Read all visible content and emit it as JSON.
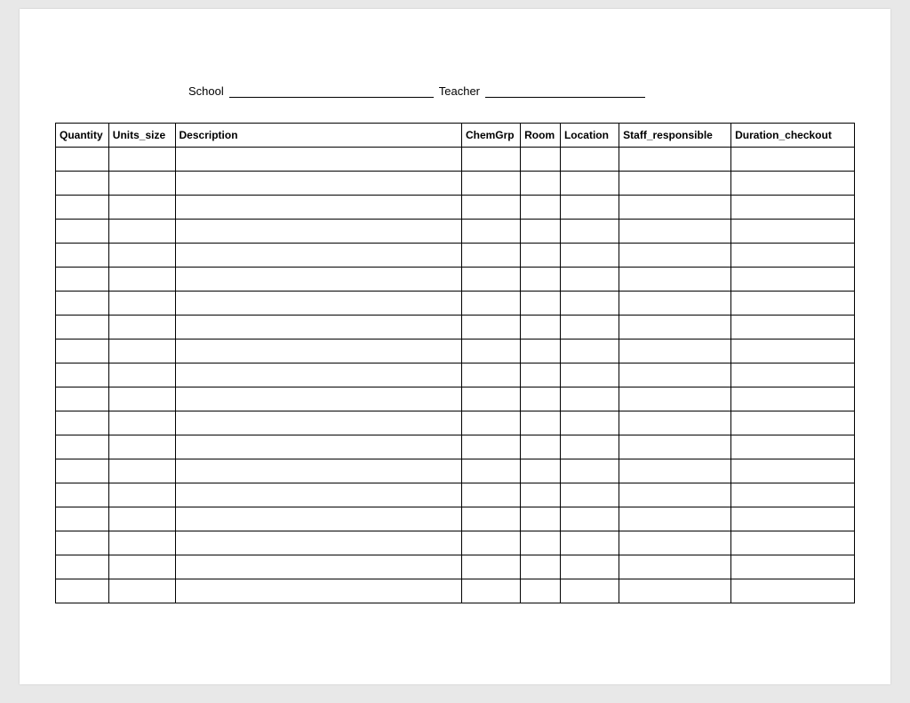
{
  "header": {
    "school_label": "School",
    "teacher_label": "Teacher"
  },
  "table": {
    "columns": [
      "Quantity",
      "Units_size",
      "Description",
      "ChemGrp",
      "Room",
      "Location",
      "Staff_responsible",
      "Duration_checkout"
    ],
    "row_count": 19
  }
}
